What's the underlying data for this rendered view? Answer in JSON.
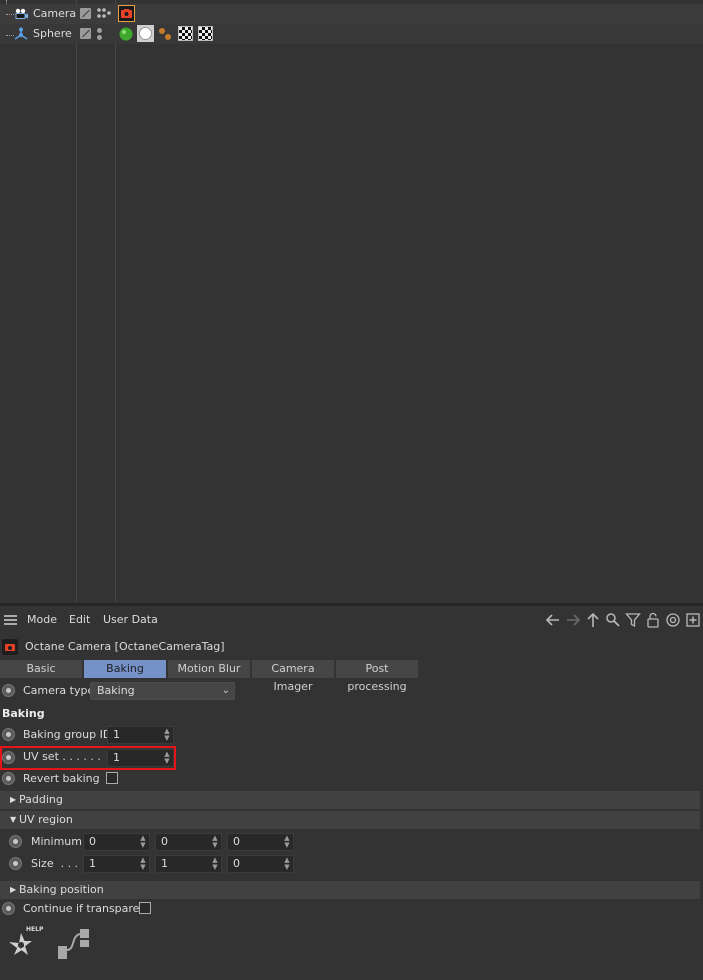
{
  "objects": [
    {
      "name": "Camera",
      "icon": "camera-object-icon"
    },
    {
      "name": "Sphere",
      "icon": "sphere-object-icon"
    }
  ],
  "menubar": {
    "items": [
      "Mode",
      "Edit",
      "User Data"
    ],
    "nav_icons": [
      "arrow-left-icon",
      "arrow-right-icon",
      "arrow-up-icon",
      "search-icon",
      "filter-icon",
      "lock-icon",
      "target-icon",
      "add-panel-icon"
    ]
  },
  "header": {
    "title": "Octane Camera [OctaneCameraTag]"
  },
  "tabs": [
    {
      "label": "Basic",
      "active": false
    },
    {
      "label": "Baking",
      "active": true
    },
    {
      "label": "Motion Blur",
      "active": false
    },
    {
      "label": "Camera Imager",
      "active": false
    },
    {
      "label": "Post processing",
      "active": false
    }
  ],
  "camera_type": {
    "label": "Camera type",
    "value": "Baking"
  },
  "baking": {
    "group_title": "Baking",
    "baking_group_id": {
      "label": "Baking group ID",
      "value": "1"
    },
    "uv_set": {
      "label": "UV set . . . . . .",
      "value": "1"
    },
    "revert_baking": {
      "label": "Revert baking  .",
      "checked": false
    }
  },
  "sections": {
    "padding": "Padding",
    "uv_region": "UV region",
    "baking_position": "Baking position"
  },
  "uv_region": {
    "minimum": {
      "label": "Minimum",
      "values": [
        "0",
        "0",
        "0"
      ]
    },
    "size": {
      "label": "Size  . . .",
      "values": [
        "1",
        "1",
        "0"
      ]
    }
  },
  "continue_if_transparent": {
    "label": "Continue if transparent",
    "checked": false
  },
  "help": {
    "label": "HELP"
  },
  "colors": {
    "accent_tab": "#7592c8",
    "highlight": "#e8141c",
    "camera_tag": "#e8412a"
  }
}
